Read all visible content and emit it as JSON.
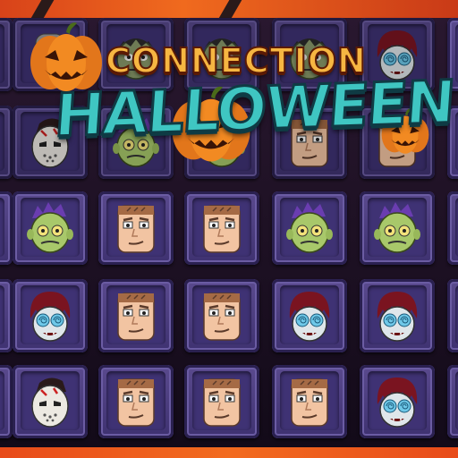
{
  "game": {
    "logo_line1": "CONNECTION",
    "logo_line2": "HALLOWEEN"
  },
  "colors": {
    "top_bar": "#f06a1e",
    "tile": "#4b3c80",
    "logo_orange": "#f6b642",
    "logo_teal": "#3fc6c2"
  },
  "board": {
    "rows": [
      [
        "ghoul",
        "pumpkin",
        "ghoul",
        "ghoul",
        "ghoul",
        "hypno-vampire"
      ],
      [
        "hockey-mask",
        "hockey-mask",
        "zombie-purple",
        "zombie-purple",
        "frankenstein",
        "frankenstein"
      ],
      [
        "hockey-mask",
        "zombie-purple",
        "frankenstein",
        "frankenstein",
        "zombie-purple",
        "zombie-purple"
      ],
      [
        "frankenstein",
        "hypno-vampire",
        "frankenstein",
        "frankenstein",
        "hypno-vampire",
        "hypno-vampire"
      ],
      [
        "hockey-mask",
        "hockey-mask",
        "frankenstein",
        "frankenstein",
        "frankenstein",
        "hypno-vampire"
      ]
    ]
  }
}
